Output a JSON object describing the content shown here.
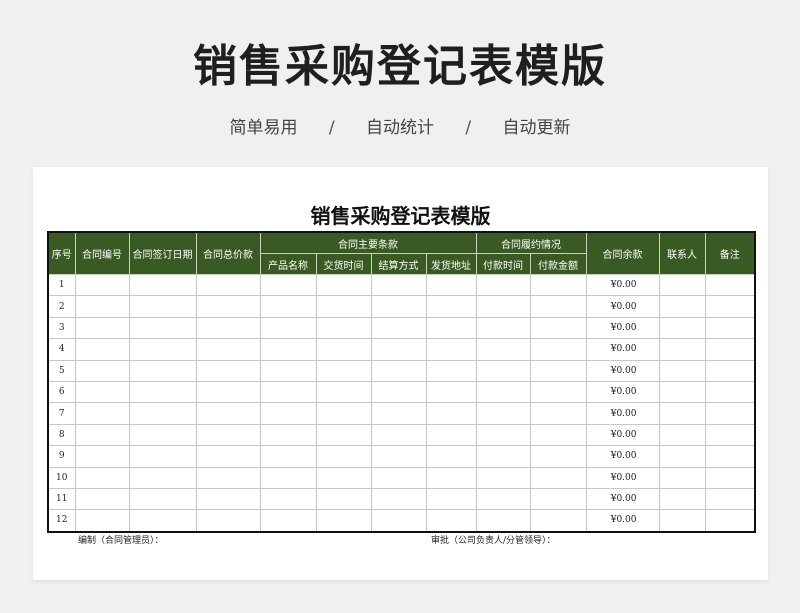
{
  "hero": {
    "title": "销售采购登记表模版",
    "features": [
      "简单易用",
      "自动统计",
      "自动更新"
    ],
    "separator": "/"
  },
  "sheet": {
    "title": "销售采购登记表模版",
    "headers": {
      "seq": "序号",
      "contract_no": "合同编号",
      "sign_date": "合同签订日期",
      "total": "合同总价款",
      "main_terms": "合同主要条款",
      "main_terms_sub": [
        "产品名称",
        "交货时间",
        "结算方式",
        "发货地址"
      ],
      "performance": "合同履约情况",
      "performance_sub": [
        "付款时间",
        "付款金额"
      ],
      "balance": "合同余款",
      "contact": "联系人",
      "remark": "备注"
    },
    "rows": [
      {
        "seq": "1",
        "balance": "¥0.00"
      },
      {
        "seq": "2",
        "balance": "¥0.00"
      },
      {
        "seq": "3",
        "balance": "¥0.00"
      },
      {
        "seq": "4",
        "balance": "¥0.00"
      },
      {
        "seq": "5",
        "balance": "¥0.00"
      },
      {
        "seq": "6",
        "balance": "¥0.00"
      },
      {
        "seq": "7",
        "balance": "¥0.00"
      },
      {
        "seq": "8",
        "balance": "¥0.00"
      },
      {
        "seq": "9",
        "balance": "¥0.00"
      },
      {
        "seq": "10",
        "balance": "¥0.00"
      },
      {
        "seq": "11",
        "balance": "¥0.00"
      },
      {
        "seq": "12",
        "balance": "¥0.00"
      }
    ],
    "footer": {
      "compiled_by": "编制（合同管理员）：",
      "approved_by": "审批（公司负责人/分管领导）："
    }
  },
  "colors": {
    "header_bg": "#3a5a23",
    "page_bg": "#eef0f2"
  }
}
